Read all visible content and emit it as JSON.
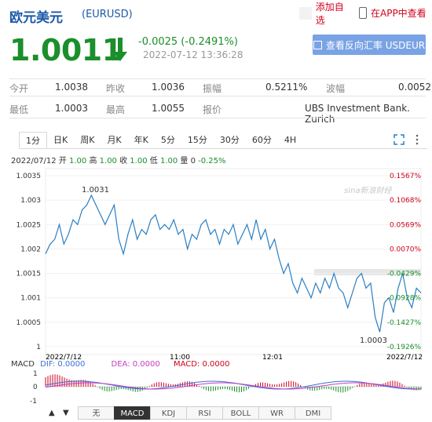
{
  "header": {
    "title": "欧元美元",
    "code": "(EURUSD)",
    "add_fav": "添加自选",
    "app_check": "在APP中查看"
  },
  "quote": {
    "price": "1.0011",
    "change": "-0.0025 (-0.2491%)",
    "time": "2022-07-12 13:36:28",
    "reverse_button": "查看反向汇率 USDEUR"
  },
  "stats": {
    "row1": [
      {
        "label": "今开",
        "value": "1.0038"
      },
      {
        "label": "昨收",
        "value": "1.0036"
      },
      {
        "label": "振幅",
        "value": "0.5211%"
      },
      {
        "label": "波幅",
        "value": "0.0052"
      }
    ],
    "row2": [
      {
        "label": "最低",
        "value": "1.0003"
      },
      {
        "label": "最高",
        "value": "1.0055"
      },
      {
        "label": "报价",
        "value": "UBS Investment Bank. Zurich"
      }
    ]
  },
  "tabs": [
    "1分",
    "日K",
    "周K",
    "月K",
    "年K",
    "5分",
    "15分",
    "30分",
    "60分",
    "4H"
  ],
  "active_tab": "1分",
  "info_line": {
    "date": "2022/07/12",
    "open_label": "开",
    "open": "1.00",
    "high_label": "高",
    "high": "1.00",
    "close_label": "收",
    "close": "1.00",
    "low_label": "低",
    "low": "1.00",
    "vol_label": "量",
    "vol": "0",
    "pct": "-0.25%"
  },
  "chart_data": {
    "type": "line",
    "y_left_ticks": [
      "1.0035",
      "1.003",
      "1.0025",
      "1.002",
      "1.0015",
      "1.001",
      "1.0005",
      "1"
    ],
    "y_right_ticks": [
      "0.1567%",
      "0.1068%",
      "0.0569%",
      "0.0070%",
      "-0.0429%",
      "-0.0928%",
      "-0.1427%",
      "-0.1926%"
    ],
    "x_ticks": [
      "2022/7/12",
      "11:00",
      "12:01",
      "2022/7/12"
    ],
    "ylim": [
      1.0,
      1.0035
    ],
    "prev_close": 1.0036,
    "high_label": "1.0031",
    "low_label": "1.0003",
    "watermark": "sina新浪财经",
    "series": [
      {
        "values": [
          1.0019,
          1.0021,
          1.0022,
          1.0025,
          1.0021,
          1.0023,
          1.0026,
          1.0025,
          1.0028,
          1.0029,
          1.0031,
          1.0029,
          1.0027,
          1.0025,
          1.0027,
          1.0029,
          1.0022,
          1.0019,
          1.0023,
          1.0026,
          1.0022,
          1.0024,
          1.0023,
          1.0026,
          1.0027,
          1.0024,
          1.0025,
          1.0024,
          1.0026,
          1.0023,
          1.0024,
          1.002,
          1.0023,
          1.0022,
          1.0025,
          1.0026,
          1.0023,
          1.0024,
          1.0021,
          1.0024,
          1.0023,
          1.0025,
          1.0021,
          1.0023,
          1.0025,
          1.0022,
          1.0026,
          1.0022,
          1.0024,
          1.002,
          1.0022,
          1.0018,
          1.0015,
          1.0017,
          1.0013,
          1.0011,
          1.0014,
          1.0012,
          1.001,
          1.0013,
          1.0011,
          1.0014,
          1.0012,
          1.0015,
          1.0012,
          1.0011,
          1.0008,
          1.0011,
          1.0014,
          1.0015,
          1.0012,
          1.0013,
          1.0006,
          1.0003,
          1.0009,
          1.001,
          1.0007,
          1.0012,
          1.0015,
          1.001,
          1.0008,
          1.0012,
          1.0011
        ]
      }
    ],
    "macd": {
      "label": "MACD",
      "dif_label": "DIF: 0.0000",
      "dea_label": "DEA: 0.0000",
      "macd_label": "MACD: 0.0000",
      "y_ticks": [
        "1",
        "0",
        "-1"
      ]
    }
  },
  "bottom_tabs": [
    "无",
    "MACD",
    "KDJ",
    "RSI",
    "BOLL",
    "WR",
    "DMI"
  ],
  "active_bottom_tab": "MACD",
  "colors": {
    "green": "#1a8f2b",
    "red": "#d0021b",
    "blue": "#1c5aa8",
    "line": "#2b7ec1"
  }
}
